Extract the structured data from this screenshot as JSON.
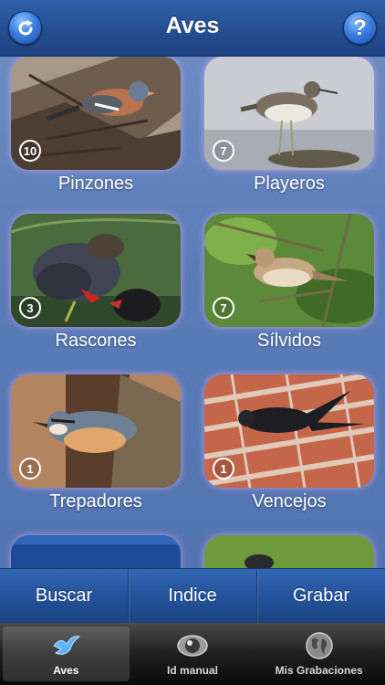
{
  "header": {
    "title": "Aves",
    "refresh_icon": "refresh-icon",
    "help_label": "?"
  },
  "groups": [
    {
      "name": "Pinzones",
      "count": "10"
    },
    {
      "name": "Playeros",
      "count": "7"
    },
    {
      "name": "Rascones",
      "count": "3"
    },
    {
      "name": "Sílvidos",
      "count": "7"
    },
    {
      "name": "Trepadores",
      "count": "1"
    },
    {
      "name": "Vencejos",
      "count": "1"
    }
  ],
  "actions": {
    "search": "Buscar",
    "index": "Indice",
    "record": "Grabar"
  },
  "tabs": {
    "birds": "Aves",
    "manual_id": "Id manual",
    "recordings": "Mis Grabaciones"
  },
  "colors": {
    "header": "#244d90",
    "background": "#5a7cb8",
    "tabbar": "#1f1f1f"
  }
}
